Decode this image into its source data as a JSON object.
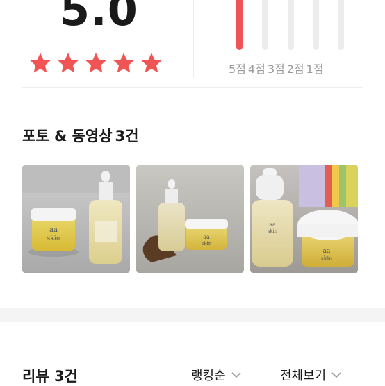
{
  "summary": {
    "score": "5.0",
    "stars_filled": 5,
    "stars_total": 5,
    "star_color": "#f05454",
    "distribution": [
      {
        "label": "5점",
        "fraction": 1.0
      },
      {
        "label": "4점",
        "fraction": 0.0
      },
      {
        "label": "3점",
        "fraction": 0.0
      },
      {
        "label": "2점",
        "fraction": 0.0
      },
      {
        "label": "1점",
        "fraction": 0.0
      }
    ],
    "bar_fill_color": "#f05454",
    "bar_track_color": "#ececec"
  },
  "photos_section": {
    "title": "포토 & 동영상",
    "count": "3건",
    "photos": [
      {
        "alt": "product-photo-1"
      },
      {
        "alt": "product-photo-2"
      },
      {
        "alt": "product-photo-3"
      }
    ]
  },
  "reviews_section": {
    "title": "리뷰",
    "count": "3건",
    "sort_label": "랭킹순",
    "filter_label": "전체보기"
  }
}
